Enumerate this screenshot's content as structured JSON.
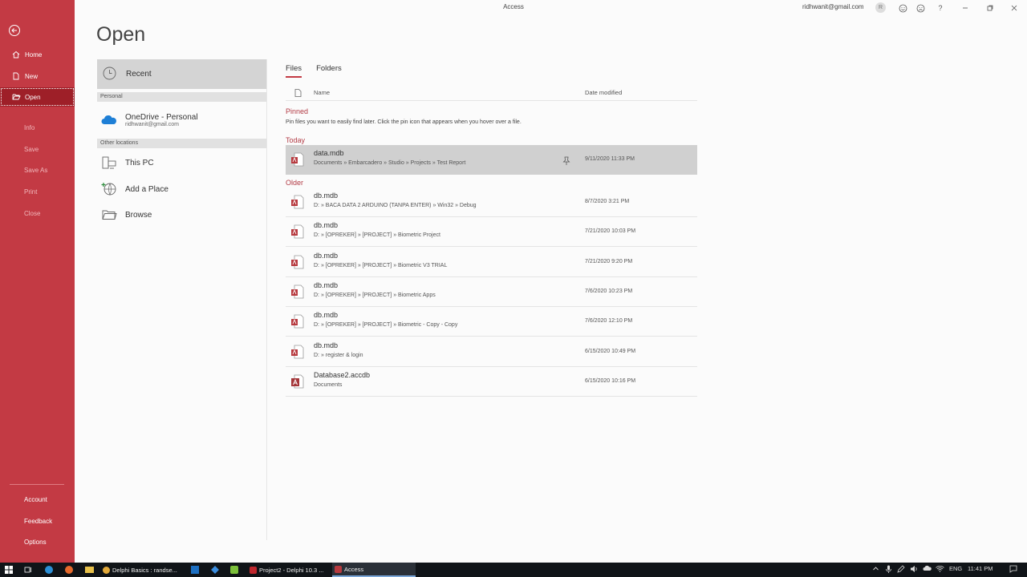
{
  "window": {
    "title": "Access",
    "user_email": "ridhwanit@gmail.com",
    "avatar_initial": "R"
  },
  "nav": {
    "items": [
      {
        "label": "Home"
      },
      {
        "label": "New"
      },
      {
        "label": "Open"
      },
      {
        "label": "Info"
      },
      {
        "label": "Save"
      },
      {
        "label": "Save As"
      },
      {
        "label": "Print"
      },
      {
        "label": "Close"
      }
    ],
    "bottom": [
      {
        "label": "Account"
      },
      {
        "label": "Feedback"
      },
      {
        "label": "Options"
      }
    ]
  },
  "page": {
    "heading": "Open"
  },
  "locations": {
    "recent_label": "Recent",
    "personal_header": "Personal",
    "onedrive_title": "OneDrive - Personal",
    "onedrive_account": "ridhwanit@gmail.com",
    "other_header": "Other locations",
    "this_pc": "This PC",
    "add_place": "Add a Place",
    "browse": "Browse"
  },
  "files": {
    "tabs": [
      "Files",
      "Folders"
    ],
    "col_name": "Name",
    "col_date": "Date modified",
    "pinned_label": "Pinned",
    "pinned_hint": "Pin files you want to easily find later. Click the pin icon that appears when you hover over a file.",
    "today_label": "Today",
    "older_label": "Older",
    "today": [
      {
        "name": "data.mdb",
        "path": "Documents » Embarcadero » Studio » Projects » Test Report",
        "date": "9/11/2020 11:33 PM"
      }
    ],
    "older": [
      {
        "name": "db.mdb",
        "path": "D: » BACA DATA 2 ARDUINO (TANPA ENTER) » Win32 » Debug",
        "date": "8/7/2020 3:21 PM",
        "type": "mdb"
      },
      {
        "name": "db.mdb",
        "path": "D: » [OPREKER] » [PROJECT] » Biometric Project",
        "date": "7/21/2020 10:03 PM",
        "type": "mdb"
      },
      {
        "name": "db.mdb",
        "path": "D: » [OPREKER] » [PROJECT] » Biometric V3 TRIAL",
        "date": "7/21/2020 9:20 PM",
        "type": "mdb"
      },
      {
        "name": "db.mdb",
        "path": "D: » [OPREKER] » [PROJECT] » Biometric Apps",
        "date": "7/6/2020 10:23 PM",
        "type": "mdb"
      },
      {
        "name": "db.mdb",
        "path": "D: » [OPREKER] » [PROJECT] » Biometric - Copy - Copy",
        "date": "7/6/2020 12:10 PM",
        "type": "mdb"
      },
      {
        "name": "db.mdb",
        "path": "D: » register & login",
        "date": "6/15/2020 10:49 PM",
        "type": "mdb"
      },
      {
        "name": "Database2.accdb",
        "path": "Documents",
        "date": "6/15/2020 10:16 PM",
        "type": "accdb"
      }
    ]
  },
  "taskbar": {
    "apps": [
      {
        "label": "Delphi Basics : randse..."
      },
      {
        "label": "Project2 - Delphi 10.3 ..."
      },
      {
        "label": "Access"
      }
    ],
    "lang": "ENG",
    "time": "11:41 PM"
  },
  "colors": {
    "accent": "#c33a44",
    "accent_dark": "#9e1f28"
  }
}
